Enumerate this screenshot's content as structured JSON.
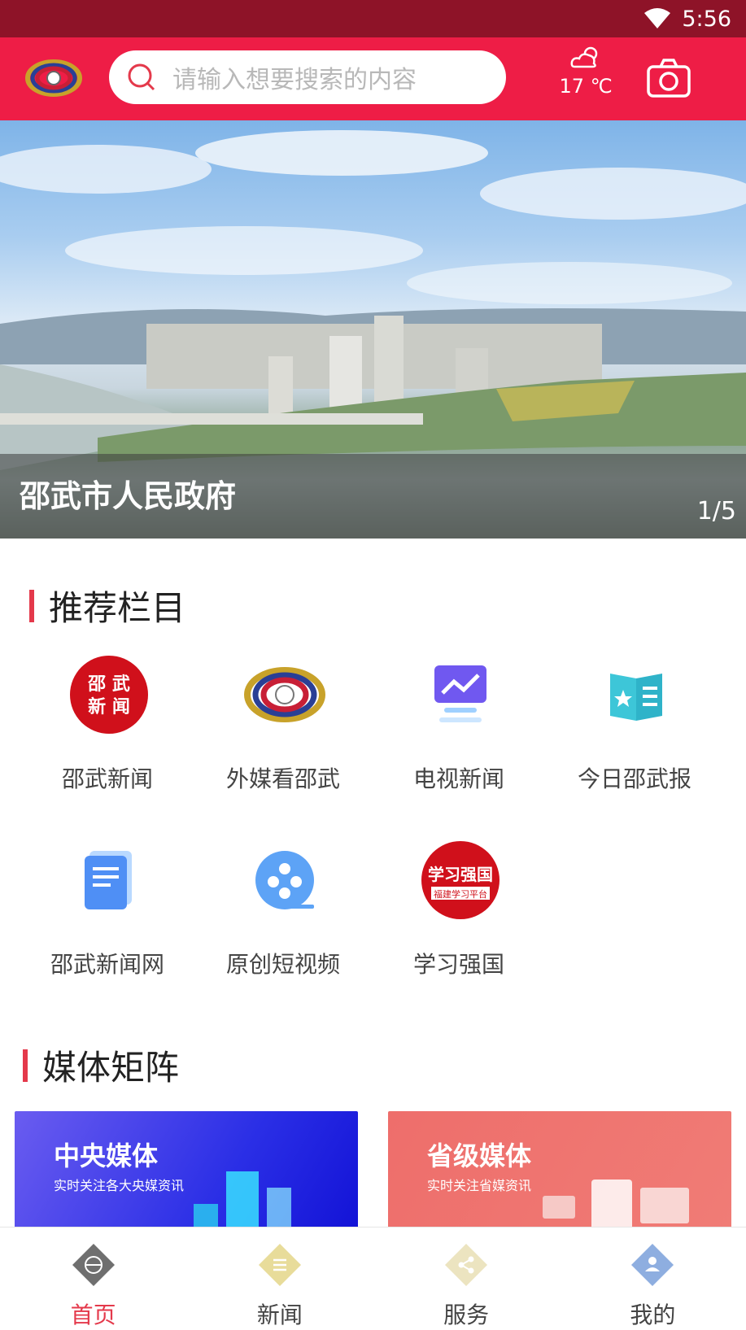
{
  "status_bar": {
    "time": "5:56"
  },
  "header": {
    "search_placeholder": "请输入想要搜索的内容",
    "weather_temp": "17 ℃"
  },
  "banner": {
    "title": "邵武市人民政府",
    "pager": "1/5"
  },
  "recommend": {
    "title": "推荐栏目",
    "items": [
      {
        "label": "邵武新闻",
        "icon": "shaowu-news-icon",
        "badge_text": "邵 武 新 闻"
      },
      {
        "label": "外媒看邵武",
        "icon": "foreign-media-logo-icon"
      },
      {
        "label": "电视新闻",
        "icon": "tv-news-icon"
      },
      {
        "label": "今日邵武报",
        "icon": "newspaper-book-icon"
      },
      {
        "label": "邵武新闻网",
        "icon": "document-icon"
      },
      {
        "label": "原创短视频",
        "icon": "film-reel-icon"
      },
      {
        "label": "学习强国",
        "icon": "xuexi-qiangguo-icon",
        "badge_text": "学习强国 福建学习平台"
      }
    ]
  },
  "media": {
    "title": "媒体矩阵",
    "cards": [
      {
        "name": "中央媒体",
        "sub": "实时关注各大央媒资讯",
        "color": "#3b3ee8"
      },
      {
        "name": "省级媒体",
        "sub": "实时关注省媒资讯",
        "color": "#ee6e6b"
      }
    ]
  },
  "tabs": [
    {
      "label": "首页",
      "icon": "globe-icon",
      "active": true
    },
    {
      "label": "新闻",
      "icon": "list-icon",
      "active": false
    },
    {
      "label": "服务",
      "icon": "share-icon",
      "active": false
    },
    {
      "label": "我的",
      "icon": "user-icon",
      "active": false
    }
  ],
  "colors": {
    "primary": "#ee1d46",
    "status_bar": "#8e1328",
    "accent": "#e4394b"
  }
}
